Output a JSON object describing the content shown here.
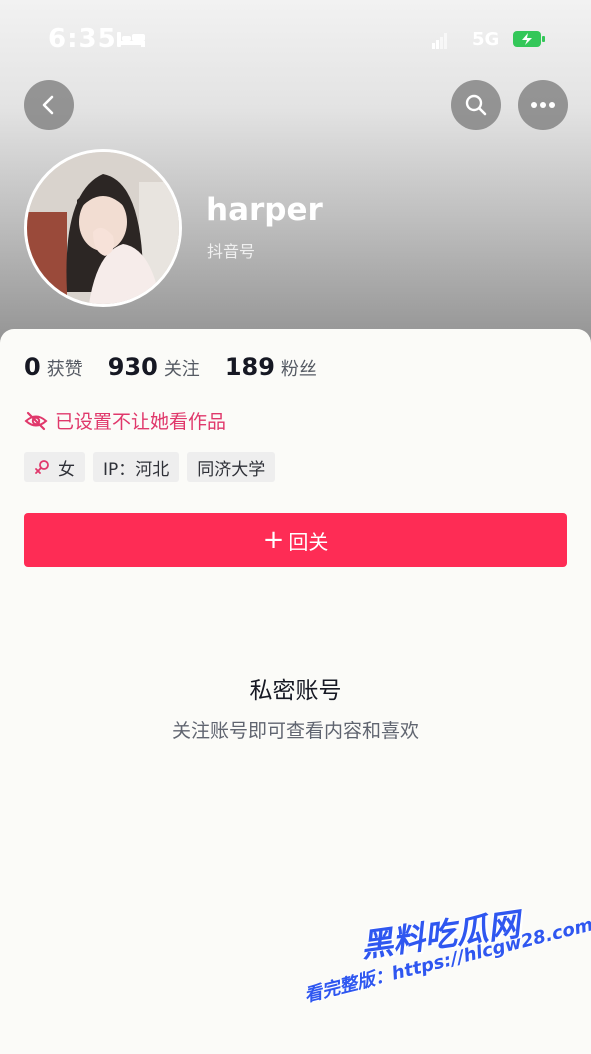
{
  "status_bar": {
    "time": "6:35",
    "network": "5G"
  },
  "profile": {
    "name": "harper",
    "douyin_id_label": "抖音号"
  },
  "stats": [
    {
      "num": "0",
      "label": "获赞"
    },
    {
      "num": "930",
      "label": "关注"
    },
    {
      "num": "189",
      "label": "粉丝"
    }
  ],
  "visibility_notice": "已设置不让她看作品",
  "tags": {
    "gender": "女",
    "ip": "IP：河北",
    "school": "同济大学"
  },
  "follow_button": {
    "icon": "+",
    "label": "回关"
  },
  "private": {
    "title": "私密账号",
    "description": "关注账号即可查看内容和喜欢"
  },
  "watermark": {
    "logo": "黑料吃瓜网",
    "url": "看完整版：https://hlcgw28.com"
  },
  "colors": {
    "accent": "#fe2c55",
    "notice": "#e0386b",
    "watermark": "#2f57f0"
  },
  "icons": [
    "bed-icon",
    "signal-icon",
    "battery-icon",
    "back-icon",
    "search-icon",
    "more-icon",
    "eye-slash-icon",
    "female-icon",
    "plus-icon"
  ]
}
